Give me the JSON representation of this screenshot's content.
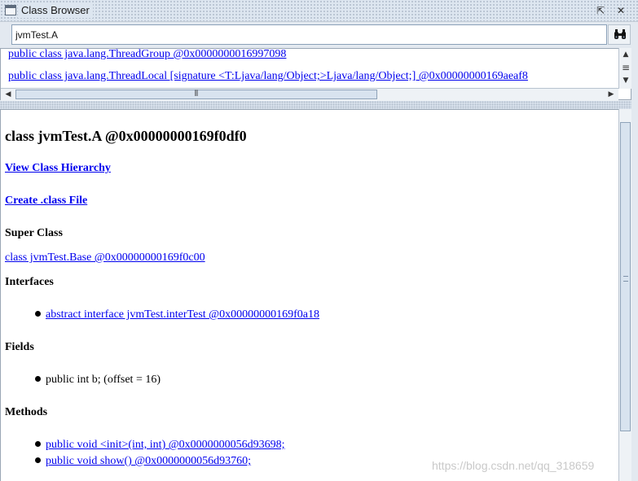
{
  "window": {
    "title": "Class Browser",
    "restore_glyph": "⇱",
    "close_glyph": "✕"
  },
  "search": {
    "value": "jvmTest.A"
  },
  "icons": {
    "window": "window-icon",
    "find": "binoculars-icon",
    "restore": "restore-icon",
    "close": "close-icon"
  },
  "class_list": {
    "items": [
      "public class java.lang.ThreadGroup @0x0000000016997098",
      "public class java.lang.ThreadLocal [signature <T:Ljava/lang/Object;>Ljava/lang/Object;] @0x00000000169aeaf8"
    ]
  },
  "detail": {
    "heading": "class jvmTest.A @0x00000000169f0df0",
    "view_hierarchy_link": "View Class Hierarchy",
    "create_class_file_link": "Create .class File",
    "super_class": {
      "label": "Super Class",
      "value": "class jvmTest.Base @0x00000000169f0c00"
    },
    "interfaces": {
      "label": "Interfaces",
      "items": [
        "abstract interface jvmTest.interTest @0x00000000169f0a18"
      ]
    },
    "fields": {
      "label": "Fields",
      "items": [
        "public int b; (offset = 16)"
      ]
    },
    "methods": {
      "label": "Methods",
      "items": [
        "public void <init>(int, int) @0x0000000056d93698;",
        "public void show() @0x0000000056d93760;"
      ]
    }
  },
  "watermark": "https://blog.csdn.net/qq_318659"
}
